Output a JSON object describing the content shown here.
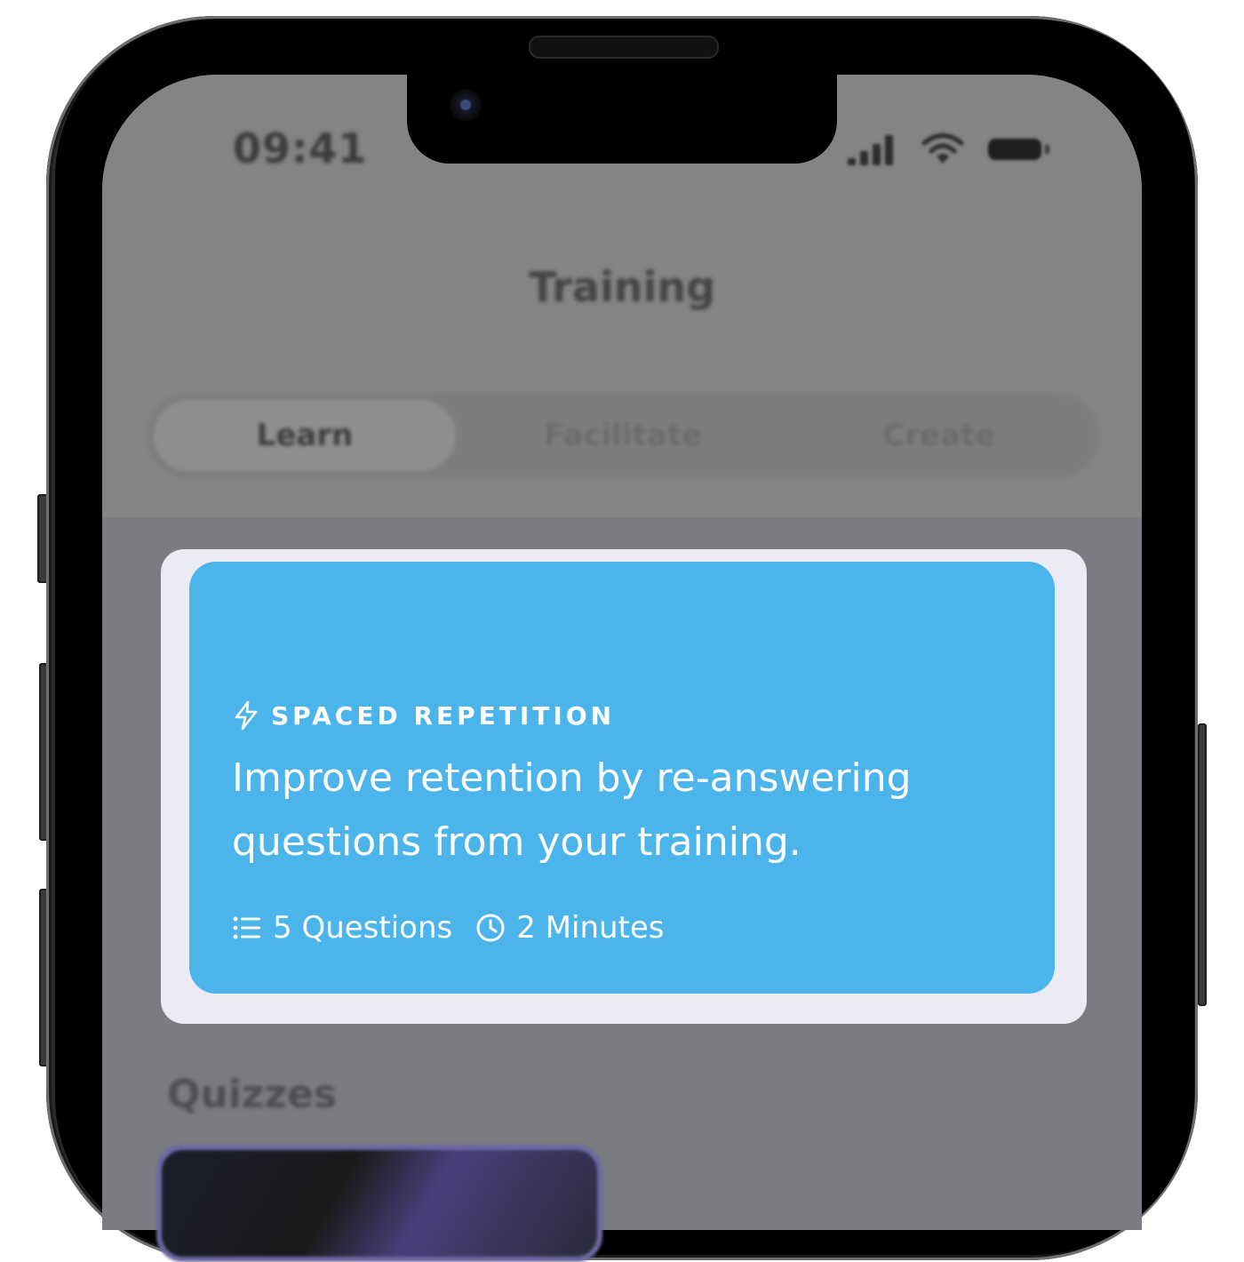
{
  "status_bar": {
    "time": "09:41",
    "icons": [
      "signal-icon",
      "wifi-icon",
      "battery-icon"
    ]
  },
  "header": {
    "title": "Training"
  },
  "tabs": [
    {
      "label": "Learn",
      "active": true
    },
    {
      "label": "Facilitate",
      "active": false
    },
    {
      "label": "Create",
      "active": false
    }
  ],
  "card": {
    "tag_icon": "lightning-icon",
    "tag": "SPACED REPETITION",
    "text": "Improve retention by re-answering questions from your training.",
    "questions_icon": "list-icon",
    "questions": "5 Questions",
    "duration_icon": "clock-icon",
    "duration": "2 Minutes",
    "color": "#4bb4ea"
  },
  "sections": {
    "quizzes_title": "Quizzes"
  }
}
